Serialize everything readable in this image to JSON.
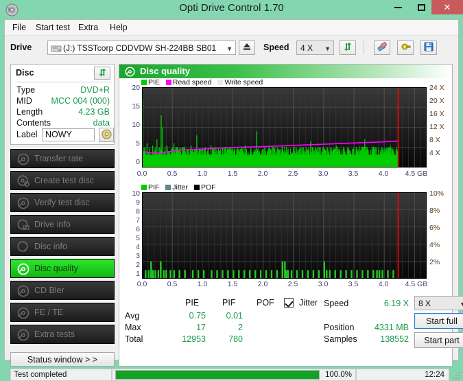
{
  "window": {
    "title": "Opti Drive Control 1.70",
    "icon": "disc-icon",
    "minimize_label": "–",
    "maximize_label": "□",
    "close_label": "✕"
  },
  "menu": {
    "items": [
      {
        "label": "File"
      },
      {
        "label": "Start test"
      },
      {
        "label": "Extra"
      },
      {
        "label": "Help"
      }
    ]
  },
  "toolbar": {
    "drive_label": "Drive",
    "drive_value": "(J:)  TSSTcorp CDDVDW SH-224BB SB01",
    "drive_icon": "drive-icon",
    "eject_label": "eject-icon",
    "speed_label": "Speed",
    "speed_value": "4 X",
    "refresh_icon": "refresh-arrows-icon",
    "eraser_icon": "eraser-icon",
    "settings_icon": "plug-settings-icon",
    "save_icon": "floppy-save-icon"
  },
  "disc": {
    "title": "Disc",
    "refresh_icon": "refresh-arrows-icon",
    "rows": [
      {
        "key": "Type",
        "value": "DVD+R"
      },
      {
        "key": "MID",
        "value": "MCC 004 (000)"
      },
      {
        "key": "Length",
        "value": "4.23 GB"
      },
      {
        "key": "Contents",
        "value": "data"
      }
    ],
    "label_key": "Label",
    "label_value": "NOWY",
    "label_button_icon": "cd-disc-icon"
  },
  "nav": {
    "items": [
      {
        "label": "Transfer rate",
        "icon": "disc-icon",
        "active": false
      },
      {
        "label": "Create test disc",
        "icon": "disc-icon",
        "active": false
      },
      {
        "label": "Verify test disc",
        "icon": "disc-icon",
        "active": false
      },
      {
        "label": "Drive info",
        "icon": "disc-icon",
        "active": false
      },
      {
        "label": "Disc info",
        "icon": "disc-icon",
        "active": false
      },
      {
        "label": "Disc quality",
        "icon": "disc-icon",
        "active": true
      },
      {
        "label": "CD Bler",
        "icon": "disc-icon",
        "active": false
      },
      {
        "label": "FE / TE",
        "icon": "disc-icon",
        "active": false
      },
      {
        "label": "Extra tests",
        "icon": "disc-icon",
        "active": false
      }
    ],
    "status_window_label": "Status window > >"
  },
  "panel": {
    "header_title": "Disc quality",
    "header_icon": "disc-icon"
  },
  "chart_data": [
    {
      "id": "pie-chart",
      "type": "line",
      "title": "PIE / Read speed / Write speed",
      "xlabel": "GB",
      "ylabel": "",
      "xlim": [
        0,
        4.7
      ],
      "ylim": [
        0,
        20
      ],
      "y2lim": [
        0,
        24
      ],
      "yticks": [
        0,
        5,
        10,
        15,
        20
      ],
      "ytick_labels": [
        "0",
        "5",
        "10",
        "15",
        "20"
      ],
      "y2ticks": [
        4,
        8,
        12,
        16,
        20,
        24
      ],
      "y2tick_labels": [
        "4 X",
        "8 X",
        "12 X",
        "16 X",
        "20 X",
        "24 X"
      ],
      "xticks": [
        0.0,
        0.5,
        1.0,
        1.5,
        2.0,
        2.5,
        3.0,
        3.5,
        4.0,
        4.5
      ],
      "xtick_labels": [
        "0.0",
        "0.5",
        "1.0",
        "1.5",
        "2.0",
        "2.5",
        "3.0",
        "3.5",
        "4.0",
        "4.5 GB"
      ],
      "x_axis_unit": "GB",
      "grid": true,
      "legend": [
        {
          "label": "PIE",
          "color": "#00cc00"
        },
        {
          "label": "Read speed",
          "color": "#ff00ff"
        },
        {
          "label": "Write speed",
          "color": "#e8e8e8"
        }
      ],
      "end_marker_x": 4.23,
      "end_marker_color": "#ff0000",
      "series": [
        {
          "name": "PIE",
          "color": "#00cc00",
          "type": "impulse",
          "baseline": 3.2,
          "values": [
            17.0,
            5.0,
            4.0,
            6.0,
            3.5,
            4.5,
            3.0,
            5.5,
            4.0,
            3.0,
            7.0,
            3.5,
            5.0,
            13.0,
            10.0,
            4.0,
            3.0,
            5.5,
            4.0,
            3.0,
            4.5,
            3.0,
            6.0,
            3.5,
            5.0,
            3.0,
            4.0,
            3.0,
            5.0,
            3.5,
            4.0,
            3.0,
            4.5,
            3.0,
            5.5,
            3.0,
            4.0,
            3.0,
            8.0,
            3.5,
            4.0,
            3.0,
            4.5,
            3.0,
            5.0,
            3.0,
            4.0,
            3.0,
            5.5,
            3.0,
            4.0,
            3.0,
            4.5,
            3.0,
            4.0,
            3.0,
            5.0,
            3.0,
            4.0,
            3.0,
            4.5,
            3.0,
            5.0,
            3.0,
            4.0,
            3.0,
            4.5,
            3.0,
            4.0,
            3.0,
            4.5,
            3.0,
            5.5,
            3.0,
            4.0,
            3.0,
            4.5,
            3.0,
            4.0,
            3.0,
            9.0,
            3.5,
            4.0,
            3.0,
            4.5,
            3.0,
            5.0,
            3.0,
            4.0,
            3.0,
            4.5,
            3.0,
            5.0,
            3.0,
            4.0,
            3.0,
            4.5,
            3.0,
            5.5,
            3.0,
            4.0,
            3.0,
            4.5,
            3.0,
            4.0,
            3.0,
            5.0,
            3.0,
            4.0,
            3.0,
            4.5,
            3.0,
            5.0,
            3.0,
            4.0,
            3.0,
            4.5,
            3.0,
            6.5,
            3.0,
            4.0,
            3.0,
            4.5,
            3.0,
            5.0,
            3.0,
            4.0,
            3.0,
            4.5,
            3.0,
            5.0,
            3.0,
            4.0,
            3.0,
            4.5,
            3.0,
            5.5,
            3.0,
            4.0,
            3.0,
            4.5,
            3.0,
            4.0,
            3.0,
            5.0,
            3.0,
            4.0,
            3.0,
            4.5,
            3.0,
            5.0,
            3.0,
            4.0,
            3.0,
            4.5,
            3.0,
            7.0,
            3.0,
            4.0,
            3.0,
            4.5,
            3.0,
            5.0,
            3.0,
            4.0,
            3.0,
            4.5,
            3.0,
            5.0,
            3.0,
            4.0,
            3.0,
            4.5,
            3.0,
            5.5,
            3.0,
            4.0,
            3.0,
            4.5,
            3.0
          ]
        },
        {
          "name": "Read speed",
          "color": "#ff00ff",
          "type": "line",
          "points": [
            [
              0.0,
              4.0
            ],
            [
              0.15,
              3.6
            ],
            [
              0.3,
              3.6
            ],
            [
              0.6,
              4.3
            ],
            [
              1.0,
              4.6
            ],
            [
              1.5,
              5.0
            ],
            [
              2.0,
              5.2
            ],
            [
              2.5,
              5.5
            ],
            [
              3.0,
              5.8
            ],
            [
              3.5,
              6.1
            ],
            [
              4.0,
              6.4
            ],
            [
              4.23,
              6.6
            ]
          ]
        }
      ],
      "avg_pie": 0.75,
      "max_pie": 17,
      "total_pie": 12953
    },
    {
      "id": "pif-chart",
      "type": "bar",
      "title": "PIF / Jitter / POF",
      "xlabel": "GB",
      "ylabel": "",
      "xlim": [
        0,
        4.7
      ],
      "ylim": [
        0,
        10
      ],
      "y2lim": [
        0,
        10
      ],
      "yticks": [
        1,
        2,
        3,
        4,
        5,
        6,
        7,
        8,
        9,
        10
      ],
      "ytick_labels": [
        "1",
        "2",
        "3",
        "4",
        "5",
        "6",
        "7",
        "8",
        "9",
        "10"
      ],
      "y2ticks": [
        2,
        4,
        6,
        8,
        10
      ],
      "y2tick_labels": [
        "2%",
        "4%",
        "6%",
        "8%",
        "10%"
      ],
      "xticks": [
        0.0,
        0.5,
        1.0,
        1.5,
        2.0,
        2.5,
        3.0,
        3.5,
        4.0,
        4.5
      ],
      "xtick_labels": [
        "0.0",
        "0.5",
        "1.0",
        "1.5",
        "2.0",
        "2.5",
        "3.0",
        "3.5",
        "4.0",
        "4.5 GB"
      ],
      "grid": true,
      "legend": [
        {
          "label": "PIF",
          "color": "#00cc00"
        },
        {
          "label": "Jitter",
          "color": "#5a8a8a"
        },
        {
          "label": "POF",
          "color": "#000000"
        }
      ],
      "end_marker_x": 4.23,
      "end_marker_color": "#ff0000",
      "series": [
        {
          "name": "PIF",
          "color": "#22cc22",
          "type": "impulse",
          "points": [
            [
              0.06,
              1
            ],
            [
              0.11,
              1
            ],
            [
              0.15,
              2
            ],
            [
              0.18,
              1
            ],
            [
              0.22,
              1
            ],
            [
              0.27,
              1
            ],
            [
              0.31,
              2
            ],
            [
              0.36,
              1
            ],
            [
              0.4,
              1
            ],
            [
              0.47,
              1
            ],
            [
              0.53,
              1
            ],
            [
              0.62,
              1
            ],
            [
              0.71,
              1
            ],
            [
              0.84,
              1
            ],
            [
              0.93,
              1
            ],
            [
              1.02,
              1
            ],
            [
              1.15,
              1
            ],
            [
              1.24,
              1
            ],
            [
              1.33,
              1
            ],
            [
              1.42,
              1
            ],
            [
              1.51,
              1
            ],
            [
              1.6,
              1
            ],
            [
              1.69,
              1
            ],
            [
              1.78,
              1
            ],
            [
              1.87,
              1
            ],
            [
              1.96,
              1
            ],
            [
              2.05,
              1
            ],
            [
              2.14,
              1
            ],
            [
              2.23,
              1
            ],
            [
              2.32,
              2
            ],
            [
              2.36,
              2
            ],
            [
              2.38,
              1
            ],
            [
              2.41,
              1
            ],
            [
              2.47,
              1
            ],
            [
              2.56,
              1
            ],
            [
              2.65,
              1
            ],
            [
              2.74,
              1
            ],
            [
              2.83,
              1
            ],
            [
              2.92,
              1
            ],
            [
              3.01,
              2
            ],
            [
              3.05,
              1
            ],
            [
              3.1,
              1
            ],
            [
              3.19,
              1
            ],
            [
              3.28,
              1
            ],
            [
              3.37,
              1
            ],
            [
              3.46,
              1
            ],
            [
              3.55,
              1
            ],
            [
              3.64,
              1
            ],
            [
              3.73,
              1
            ],
            [
              3.82,
              1
            ],
            [
              3.88,
              1
            ],
            [
              3.92,
              1
            ],
            [
              3.97,
              1
            ],
            [
              4.06,
              1
            ],
            [
              4.15,
              1
            ]
          ]
        }
      ],
      "avg_pif": 0.01,
      "max_pif": 2,
      "total_pif": 780
    }
  ],
  "stats": {
    "col_pie": "PIE",
    "col_pif": "PIF",
    "col_pof": "POF",
    "jitter_label": "Jitter",
    "jitter_checked": true,
    "rows": [
      {
        "label": "Avg",
        "pie": "0.75",
        "pif": "0.01",
        "pof": ""
      },
      {
        "label": "Max",
        "pie": "17",
        "pif": "2",
        "pof": ""
      },
      {
        "label": "Total",
        "pie": "12953",
        "pif": "780",
        "pof": ""
      }
    ],
    "speed_label": "Speed",
    "speed_value": "6.19 X",
    "position_label": "Position",
    "position_value": "4331 MB",
    "samples_label": "Samples",
    "samples_value": "138552",
    "speed_select_value": "8 X",
    "start_full_label": "Start full",
    "start_part_label": "Start part"
  },
  "statusbar": {
    "message": "Test completed",
    "progress_percent": 100.0,
    "progress_text": "100.0%",
    "time": "12:24"
  }
}
